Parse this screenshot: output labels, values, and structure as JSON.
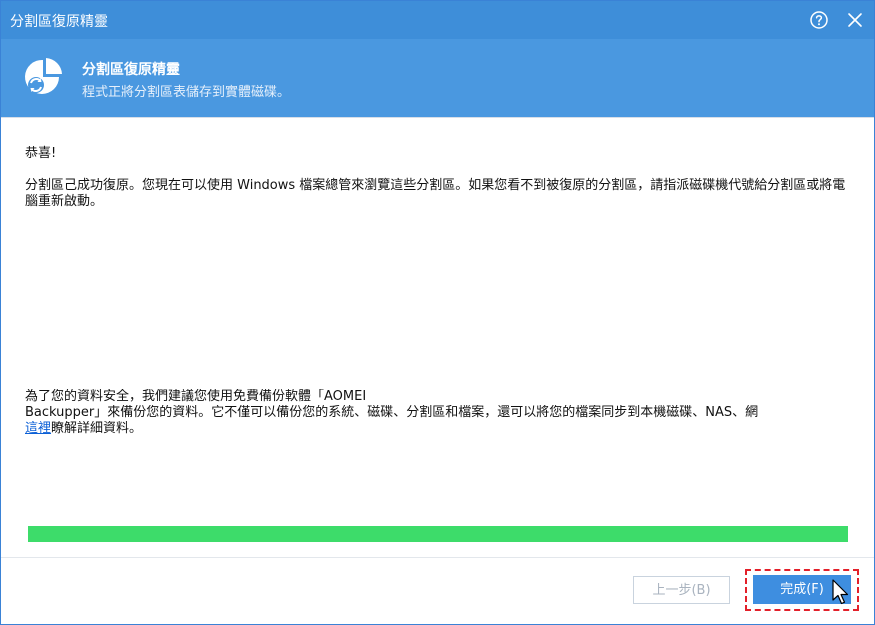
{
  "window": {
    "title": "分割區復原精靈"
  },
  "header": {
    "title": "分割區復原精靈",
    "subtitle": "程式正將分割區表儲存到實體磁碟。"
  },
  "content": {
    "congrats": "恭喜!",
    "success_message": "分割區己成功復原。您現在可以使用 Windows 檔案總管來瀏覽這些分割區。如果您看不到被復原的分割區，請指派磁碟機代號給分割區或將電腦重新啟動。",
    "recommend_line1": "為了您的資料安全，我們建議您使用免費備份軟體「AOMEI",
    "recommend_line2": "Backupper」來備份您的資料。它不僅可以備份您的系統、磁碟、分割區和檔案，還可以將您的檔案同步到本機磁碟、NAS、網",
    "link_text": "這裡",
    "after_link": "瞭解詳細資料。"
  },
  "progress": {
    "percent": 100,
    "color": "#3ddc6a"
  },
  "buttons": {
    "back_label": "上一步(B)",
    "finish_label": "完成(F)"
  },
  "icons": {
    "help": "help-circle-icon",
    "close": "close-icon",
    "app": "partition-recovery-icon",
    "cursor": "mouse-pointer-icon"
  },
  "colors": {
    "title_bar": "#3e8ed9",
    "header_bg": "#4a98e0",
    "accent": "#3e8ee0",
    "highlight_outline": "#e3202a"
  }
}
